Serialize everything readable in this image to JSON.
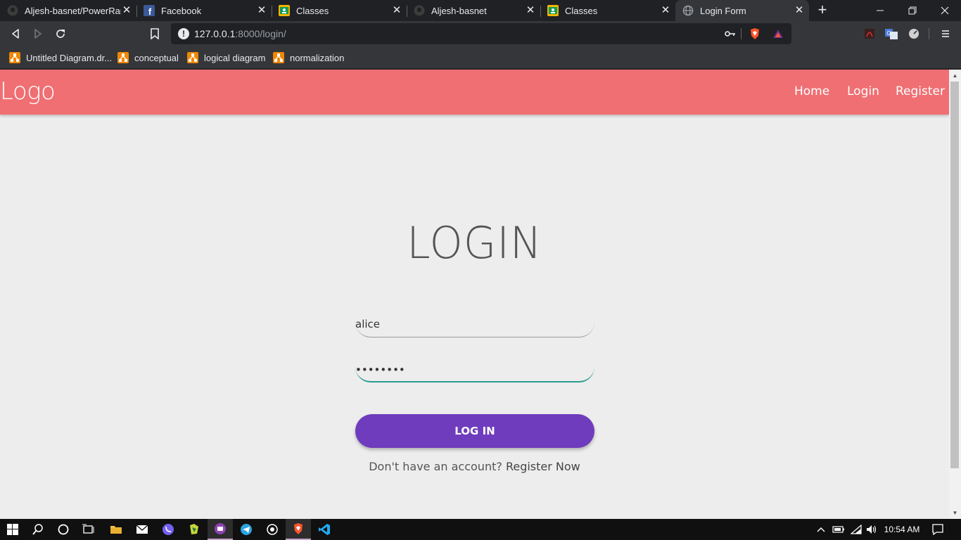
{
  "browser": {
    "tabs": [
      {
        "title": "Aljesh-basnet/PowerRang",
        "icon": "github-icon"
      },
      {
        "title": "Facebook",
        "icon": "facebook-icon"
      },
      {
        "title": "Classes",
        "icon": "classroom-icon"
      },
      {
        "title": "Aljesh-basnet",
        "icon": "github-icon"
      },
      {
        "title": "Classes",
        "icon": "classroom-icon"
      },
      {
        "title": "Login Form",
        "icon": "globe-icon",
        "active": true
      }
    ],
    "close_glyph": "✕",
    "url": {
      "host": "127.0.0.1",
      "rest": ":8000/login/"
    },
    "bookmarks": [
      {
        "label": "Untitled Diagram.dr...",
        "icon": "drawio-icon"
      },
      {
        "label": "conceptual",
        "icon": "drawio-icon"
      },
      {
        "label": "logical diagram",
        "icon": "drawio-icon"
      },
      {
        "label": "normalization",
        "icon": "drawio-icon"
      }
    ]
  },
  "site": {
    "logo": "Logo",
    "nav": {
      "home": "Home",
      "login": "Login",
      "register": "Register"
    }
  },
  "form": {
    "title": "LOGIN",
    "username_value": "alice",
    "password_value": "••••••••",
    "submit_label": "LOG IN",
    "register_prompt": "Don't have an account?",
    "register_link": "Register Now"
  },
  "taskbar": {
    "clock": "10:54 AM"
  },
  "colors": {
    "navbar": "#ef6f73",
    "button": "#6f3cbd",
    "focus": "#2a9d8f"
  }
}
